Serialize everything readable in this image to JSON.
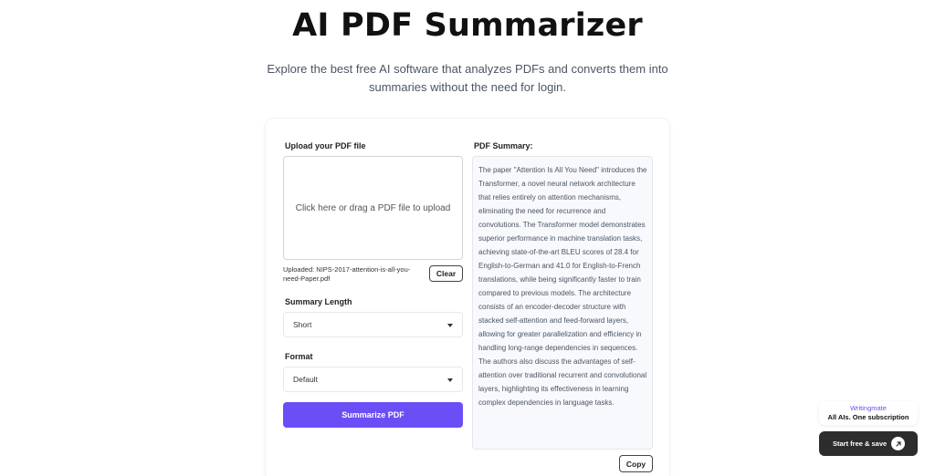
{
  "header": {
    "title": "AI PDF Summarizer",
    "subtitle": "Explore the best free AI software that analyzes PDFs and converts them into summaries without the need for login."
  },
  "upload": {
    "label": "Upload your PDF file",
    "dropzone_text": "Click here or drag a PDF file to upload",
    "uploaded_text": "Uploaded: NIPS-2017-attention-is-all-you-need-Paper.pdf",
    "clear_label": "Clear"
  },
  "options": {
    "length_label": "Summary Length",
    "length_value": "Short",
    "format_label": "Format",
    "format_value": "Default"
  },
  "summarize_label": "Summarize PDF",
  "summary": {
    "label": "PDF Summary:",
    "text": "The paper \"Attention Is All You Need\" introduces the Transformer, a novel neural network architecture that relies entirely on attention mechanisms, eliminating the need for recurrence and convolutions. The Transformer model demonstrates superior performance in machine translation tasks, achieving state-of-the-art BLEU scores of 28.4 for English-to-German and 41.0 for English-to-French translations, while being significantly faster to train compared to previous models. The architecture consists of an encoder-decoder structure with stacked self-attention and feed-forward layers, allowing for greater parallelization and efficiency in handling long-range dependencies in sequences. The authors also discuss the advantages of self-attention over traditional recurrent and convolutional layers, highlighting its effectiveness in learning complex dependencies in language tasks.",
    "copy_label": "Copy"
  },
  "promo": {
    "brand": "Writingmate",
    "tagline": "All AIs. One subscription",
    "cta_label": "Start free & save",
    "cta_icon": "arrow-up-right-icon"
  },
  "colors": {
    "accent": "#6b4ef6",
    "promo_button": "#2d2d2d",
    "summary_bg": "#f7f9fc"
  }
}
